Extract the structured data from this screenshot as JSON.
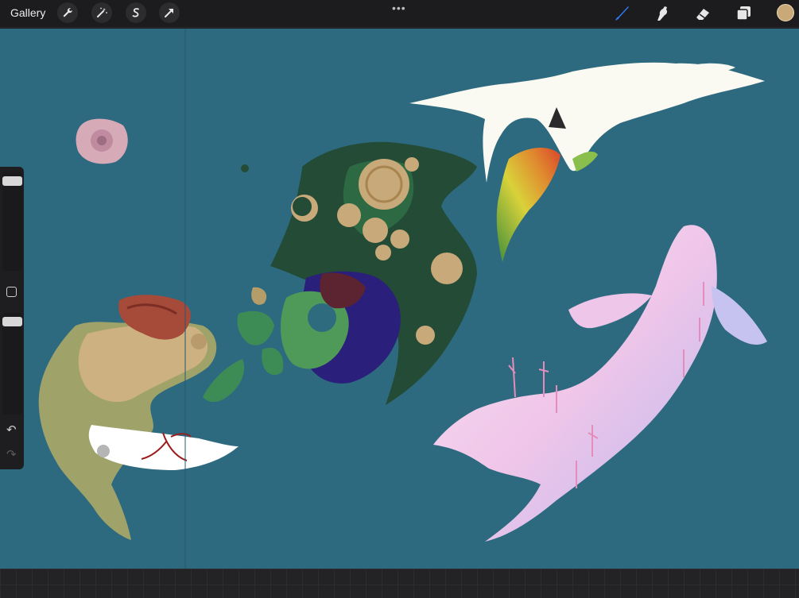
{
  "toolbar": {
    "gallery_label": "Gallery",
    "left_tools": [
      "wrench-icon",
      "magic-wand-icon",
      "selection-s-icon",
      "transform-arrow-icon"
    ],
    "more_menu": "•••",
    "right_tools": [
      "brush-icon",
      "smudge-icon",
      "eraser-icon",
      "layers-icon"
    ],
    "active_tool": "brush-icon",
    "active_color": "#c9a978"
  },
  "sidebar": {
    "brush_size_level": 0.0,
    "opacity_level": 0.0,
    "modify_button": "square-icon",
    "undo": "undo-icon",
    "redo": "redo-icon"
  },
  "canvas": {
    "background_color": "#2e6a7f"
  }
}
